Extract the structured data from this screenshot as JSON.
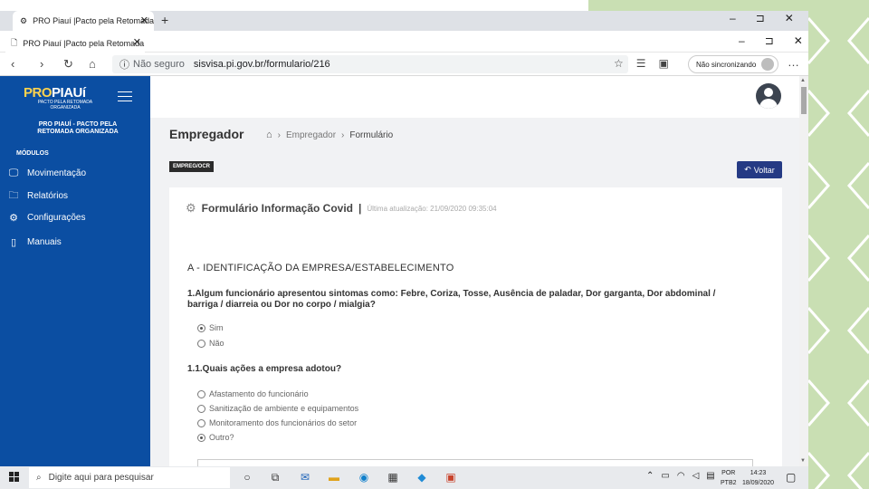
{
  "outer_browser": {
    "tab_title": "PRO Piauí |Pacto pela Retomada",
    "new_tab": "+",
    "controls": [
      "–",
      "⊐",
      "✕"
    ]
  },
  "inner_browser": {
    "tab_title": "PRO Piauí |Pacto pela Retomada",
    "tab_close": "✕",
    "controls": [
      "–",
      "⊐",
      "✕"
    ],
    "address": {
      "insecure_label": "Não seguro",
      "url": "sisvisa.pi.gov.br/formulario/216"
    },
    "profile_label": "Não sincronizando",
    "menu": "…"
  },
  "app": {
    "logo_main_a": "PRO",
    "logo_main_b": "PIAUí",
    "logo_sub": "PACTO PELA RETOMADA ORGANIZADA",
    "sidebar_subtitle": "PRO PIAUÍ - PACTO PELA RETOMADA ORGANIZADA",
    "modules_label": "MÓDULOS",
    "sidebar_items": [
      {
        "label": "Movimentação",
        "icon": "monitor-icon"
      },
      {
        "label": "Relatórios",
        "icon": "folder-icon"
      },
      {
        "label": "Configurações",
        "icon": "cog-icon"
      },
      {
        "label": "Manuais",
        "icon": "book-icon"
      }
    ],
    "page_title": "Empregador",
    "breadcrumb": [
      "Empregador",
      "Formulário"
    ],
    "tag": "EMPREG/OCR",
    "back_button": "Voltar",
    "card": {
      "title": "Formulário Informação Covid",
      "updated": "Última atualização: 21/09/2020 09:35:04",
      "section": "A - IDENTIFICAÇÃO DA EMPRESA/ESTABELECIMENTO",
      "question1": "1.Algum funcionário apresentou sintomas como: Febre, Coriza, Tosse, Ausência de paladar, Dor garganta, Dor abdominal / barriga / diarreia ou Dor no corpo / mialgia?",
      "q1_options": [
        {
          "label": "Sim",
          "checked": true
        },
        {
          "label": "Não",
          "checked": false
        }
      ],
      "question11": "1.1.Quais ações a empresa adotou?",
      "q11_options": [
        {
          "label": "Afastamento do funcionário",
          "checked": false
        },
        {
          "label": "Sanitização de ambiente e equipamentos",
          "checked": false
        },
        {
          "label": "Monitoramento dos funcionários do setor",
          "checked": false
        },
        {
          "label": "Outro?",
          "checked": true
        }
      ]
    }
  },
  "taskbar": {
    "search_placeholder": "Digite aqui para pesquisar",
    "lang": [
      "POR",
      "PTB2"
    ],
    "time": "14:23",
    "date": "18/09/2020"
  },
  "colors": {
    "sidebar": "#0b4ea2",
    "back_button": "#253a84",
    "deco": "#c9dfb3"
  }
}
